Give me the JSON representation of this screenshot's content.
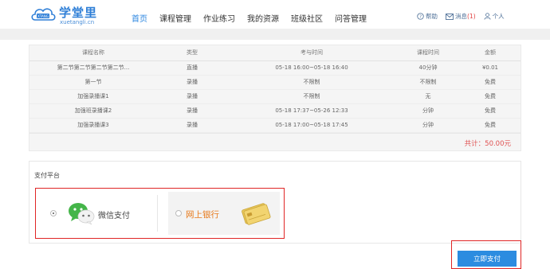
{
  "header": {
    "logo_title": "学堂里",
    "logo_sub": "xuetangli.cn",
    "logo_badge": "XTANG",
    "nav": [
      "首页",
      "课程管理",
      "作业练习",
      "我的资源",
      "班级社区",
      "问答管理"
    ],
    "help": "帮助",
    "messages": "消息",
    "message_count": "(1)",
    "personal": "个人"
  },
  "order": {
    "columns": [
      "课程名称",
      "类型",
      "考与时间",
      "课程时间",
      "金额"
    ],
    "rows": [
      [
        "第二节第二节第二节第二节...",
        "直播",
        "05-18 16:00~05-18 16:40",
        "40分钟",
        "¥0.01"
      ],
      [
        "第一节",
        "录播",
        "不限制",
        "不限制",
        "免费"
      ],
      [
        "加强录播课1",
        "录播",
        "不限制",
        "无",
        "免费"
      ],
      [
        "加强班录播课2",
        "录播",
        "05-18 17:37~05-26 12:33",
        "分钟",
        "免费"
      ],
      [
        "加强录播课3",
        "录播",
        "05-18 17:00~05-18 17:45",
        "分钟",
        "免费"
      ]
    ],
    "total": "共计：50.00元"
  },
  "payment": {
    "title": "支付平台",
    "wechat": "微信支付",
    "bank": "网上银行",
    "submit": "立即支付"
  },
  "colors": {
    "brand_blue": "#2b86e0",
    "highlight_red": "#e02525",
    "bank_orange": "#e77a1b"
  }
}
